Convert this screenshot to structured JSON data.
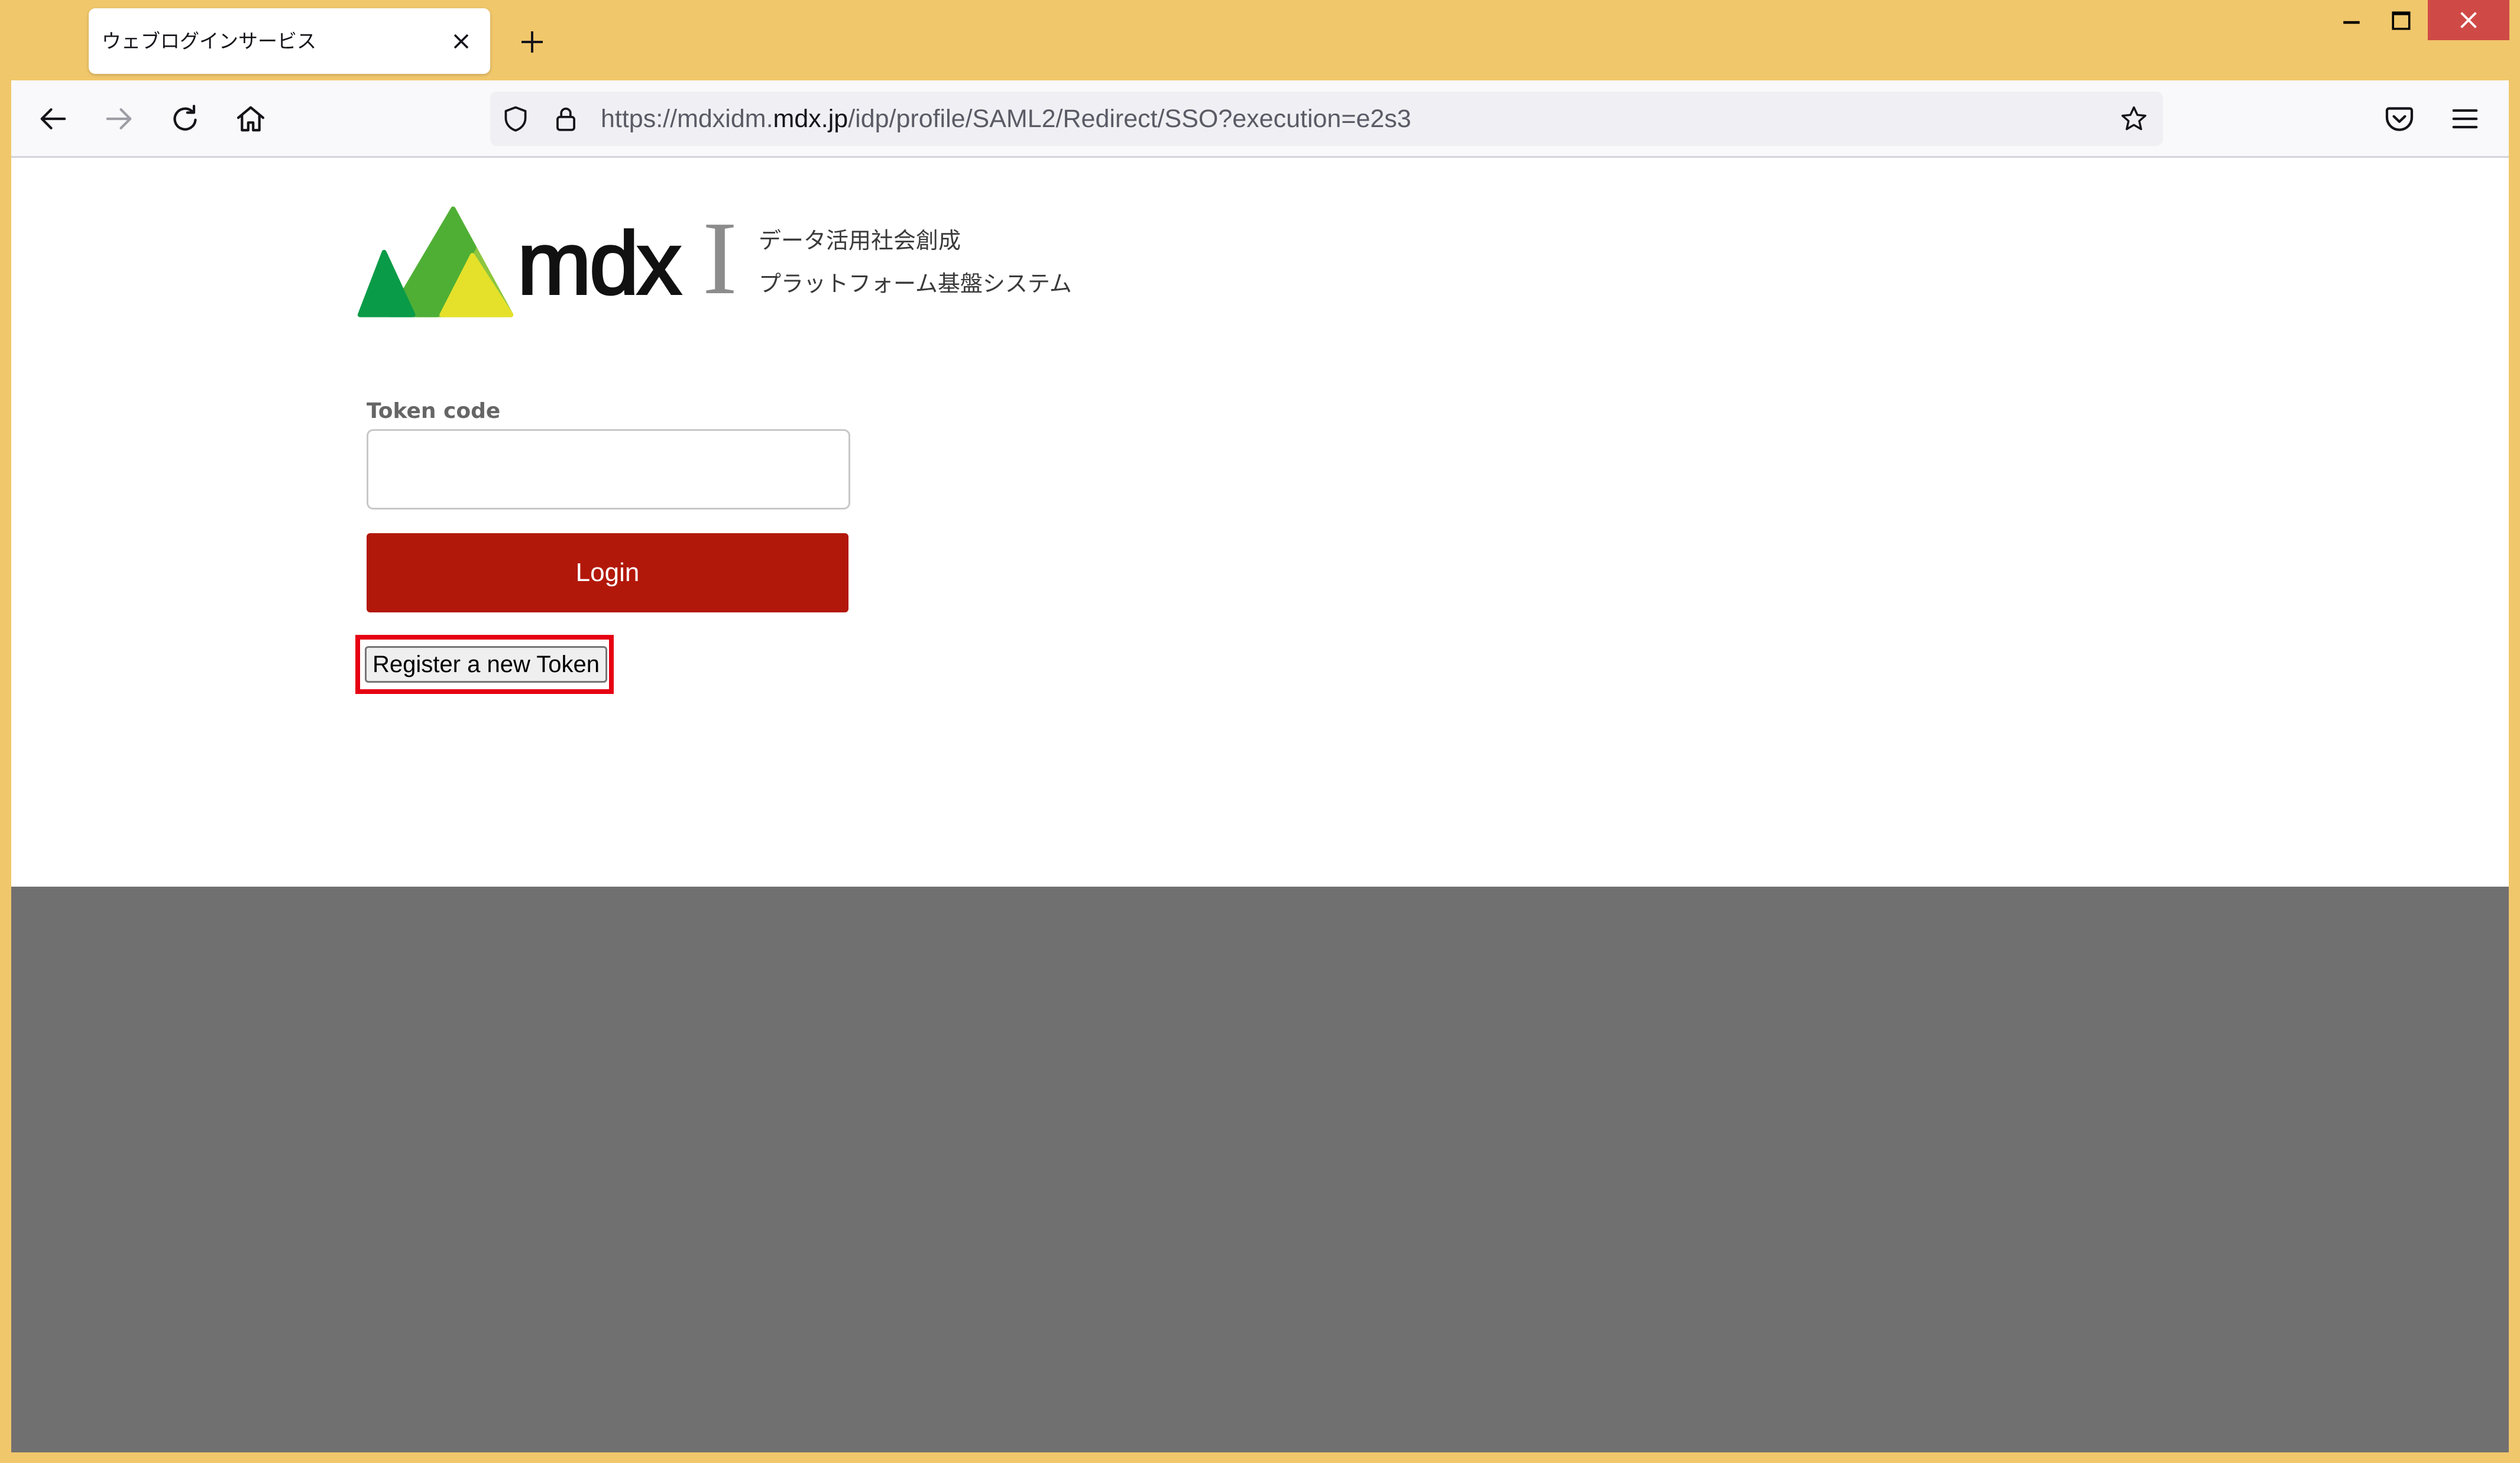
{
  "window": {
    "tab": {
      "title": "ウェブログインサービス",
      "close_icon": "close-icon"
    },
    "new_tab_icon": "plus-icon",
    "controls": [
      "minimize-icon",
      "maximize-icon",
      "close-icon"
    ]
  },
  "toolbar": {
    "nav_icons": [
      "back-arrow-icon",
      "forward-arrow-icon",
      "reload-icon",
      "home-icon"
    ],
    "url": {
      "prefix": "https://mdxidm.",
      "domain": "mdx.jp",
      "path": "/idp/profile/SAML2/Redirect/SSO?execution=e2s3"
    },
    "url_icons": [
      "shield-icon",
      "lock-icon",
      "star-icon"
    ],
    "right_icons": [
      "pocket-icon",
      "hamburger-menu-icon"
    ]
  },
  "page": {
    "logo": {
      "wordmark": "mdx",
      "mark": "I",
      "tagline_1": "データ活用社会創成",
      "tagline_2": "プラットフォーム基盤システム"
    },
    "form": {
      "token_label": "Token code",
      "token_value": "",
      "login_label": "Login",
      "register_label": "Register a new Token"
    }
  },
  "colors": {
    "window_frame": "#F1C76B",
    "login_button": "#B2180A",
    "highlight_box": "#E60012",
    "lower_area": "#707070",
    "window_close": "#CF4A47"
  }
}
